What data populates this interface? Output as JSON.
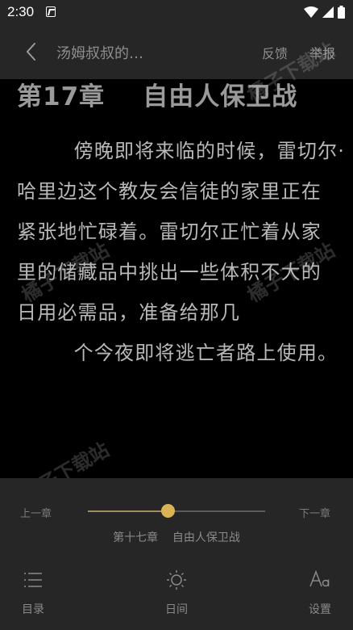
{
  "status": {
    "time": "2:30",
    "app_icon": "a-letter-icon",
    "icons": [
      "wifi-icon",
      "signal-icon",
      "battery-icon"
    ]
  },
  "top_bar": {
    "back_icon": "chevron-left-icon",
    "title": "汤姆叔叔的…",
    "feedback": "反馈",
    "report": "举报"
  },
  "reader": {
    "chapter_title": "第17章    自由人保卫战",
    "paragraph_lines": [
      "        傍晚即将来临的时候，雷切尔·",
      "哈里边这个教友会信徒的家里正在",
      "紧张地忙碌着。雷切尔正忙着从家",
      "里的储藏品中挑出一些体积不大的",
      "日用必需品，准备给那几",
      "        个今夜即将逃亡者路上使用。"
    ]
  },
  "watermark": "橘子下载站",
  "bottom_panel": {
    "prev_chapter": "上一章",
    "next_chapter": "下一章",
    "progress": 0.45,
    "chapter_caption": "第十七章    自由人保卫战",
    "nav": [
      {
        "label": "目录",
        "icon": "list-icon"
      },
      {
        "label": "日间",
        "icon": "sun-icon"
      },
      {
        "label": "设置",
        "icon": "font-settings-icon"
      }
    ]
  },
  "colors": {
    "bar_background": "#262626",
    "reader_background": "#000000",
    "accent": "#d9b355"
  }
}
